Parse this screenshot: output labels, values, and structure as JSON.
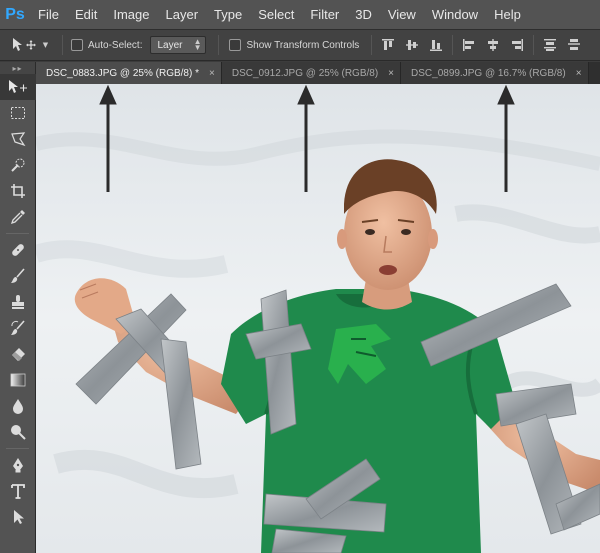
{
  "app": {
    "logo": "Ps"
  },
  "menu": [
    "File",
    "Edit",
    "Image",
    "Layer",
    "Type",
    "Select",
    "Filter",
    "3D",
    "View",
    "Window",
    "Help"
  ],
  "options": {
    "auto_select_label": "Auto-Select:",
    "layer_select_value": "Layer",
    "transform_label": "Show Transform Controls"
  },
  "tabs": [
    {
      "label": "DSC_0883.JPG @ 25% (RGB/8) *",
      "close": "×",
      "active": true
    },
    {
      "label": "DSC_0912.JPG @ 25% (RGB/8)",
      "close": "×",
      "active": false
    },
    {
      "label": "DSC_0899.JPG @ 16.7% (RGB/8)",
      "close": "×",
      "active": false
    }
  ],
  "tools": [
    "move-tool-icon",
    "marquee-tool-icon",
    "lasso-tool-icon",
    "quick-select-tool-icon",
    "crop-tool-icon",
    "eyedropper-tool-icon",
    "healing-brush-tool-icon",
    "brush-tool-icon",
    "clone-stamp-tool-icon",
    "history-brush-tool-icon",
    "eraser-tool-icon",
    "gradient-tool-icon",
    "blur-tool-icon",
    "dodge-tool-icon",
    "pen-tool-icon",
    "type-tool-icon",
    "path-select-tool-icon"
  ],
  "colors": {
    "accent": "#31a8ff",
    "menubar": "#535353",
    "shirt": "#1f8a4c",
    "tape": "#9aa0a5",
    "sheet": "#e9ecef"
  }
}
